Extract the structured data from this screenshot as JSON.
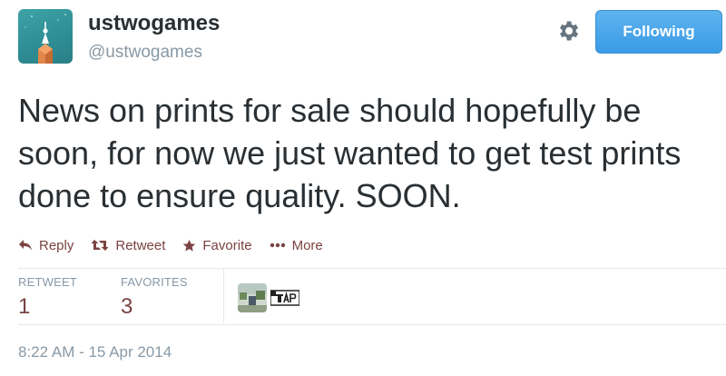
{
  "user": {
    "name": "ustwogames",
    "handle": "@ustwogames"
  },
  "header": {
    "settings_icon": "gear-icon",
    "follow_label": "Following",
    "follow_color": "#3a9be6"
  },
  "tweet": {
    "text": "News on prints for sale should hopefully be soon, for now we just wanted to get test prints done to ensure quality. SOON."
  },
  "actions": {
    "reply": "Reply",
    "retweet": "Retweet",
    "favorite": "Favorite",
    "more": "More",
    "color": "#7a4242"
  },
  "stats": {
    "retweets_label": "RETWEET",
    "retweets_value": "1",
    "favorites_label": "FAVORITES",
    "favorites_value": "3"
  },
  "timestamp": "8:22 AM - 15 Apr 2014"
}
